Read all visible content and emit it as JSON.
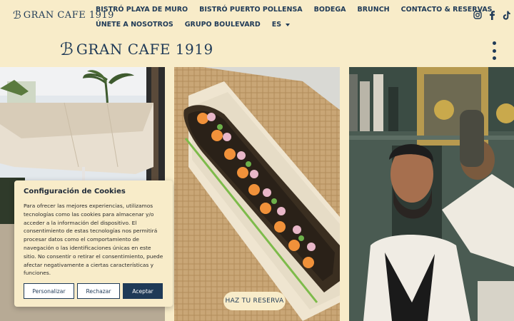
{
  "brand": {
    "name": "GRAN CAFE 1919",
    "mark": "ℬ"
  },
  "nav": {
    "row1": [
      "BISTRÓ PLAYA DE MURO",
      "BISTRÓ PUERTO POLLENSA",
      "BODEGA",
      "BRUNCH",
      "CONTACTO & RESERVAS"
    ],
    "row2": [
      "ÚNETE A NOSOTROS",
      "GRUPO BOULEVARD"
    ],
    "language": "ES"
  },
  "social": [
    "instagram-icon",
    "facebook-icon",
    "tiktok-icon"
  ],
  "cta": {
    "reserve": "HAZ TU RESERVA"
  },
  "cookie": {
    "title": "Configuración de Cookies",
    "body": "Para ofrecer las mejores experiencias, utilizamos tecnologías como las cookies para almacenar y/o acceder a la información del dispositivo. El consentimiento de estas tecnologías nos permitirá procesar datos como el comportamiento de navegación o las identificaciones únicas en este sitio. No consentir o retirar el consentimiento, puede afectar negativamente a ciertas características y funciones.",
    "buttons": {
      "customize": "Personalizar",
      "reject": "Rechazar",
      "accept": "Aceptar"
    }
  },
  "colors": {
    "background": "#f8ecc9",
    "brand": "#1f3a57"
  }
}
